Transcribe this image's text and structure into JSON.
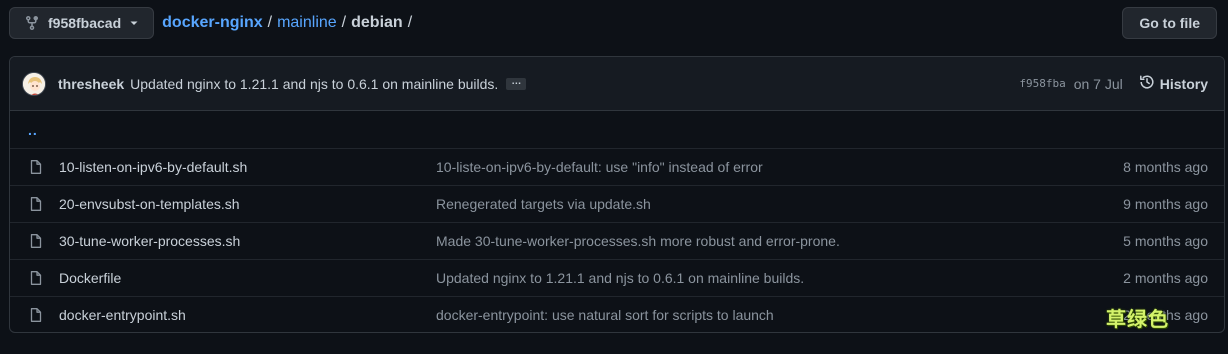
{
  "branch": {
    "label": "f958fbacad"
  },
  "breadcrumb": {
    "repo": "docker-nginx",
    "sep1": "/",
    "dir": "mainline",
    "sep2": "/",
    "current": "debian",
    "sep3": "/"
  },
  "goto_file": {
    "label": "Go to file"
  },
  "commit": {
    "author": "thresheek",
    "message": "Updated nginx to 1.21.1 and njs to 0.6.1 on mainline builds.",
    "ellipsis": "…",
    "sha": "f958fba",
    "date": "on 7 Jul",
    "history_label": "History"
  },
  "parent_link": "..",
  "files": [
    {
      "name": "10-listen-on-ipv6-by-default.sh",
      "commit": "10-liste-on-ipv6-by-default: use \"info\" instead of error",
      "age": "8 months ago"
    },
    {
      "name": "20-envsubst-on-templates.sh",
      "commit": "Renegerated targets via update.sh",
      "age": "9 months ago"
    },
    {
      "name": "30-tune-worker-processes.sh",
      "commit": "Made 30-tune-worker-processes.sh more robust and error-prone.",
      "age": "5 months ago"
    },
    {
      "name": "Dockerfile",
      "commit": "Updated nginx to 1.21.1 and njs to 0.6.1 on mainline builds.",
      "age": "2 months ago"
    },
    {
      "name": "docker-entrypoint.sh",
      "commit": "docker-entrypoint: use natural sort for scripts to launch",
      "age": "2 months ago"
    }
  ],
  "watermark": "草绿色"
}
